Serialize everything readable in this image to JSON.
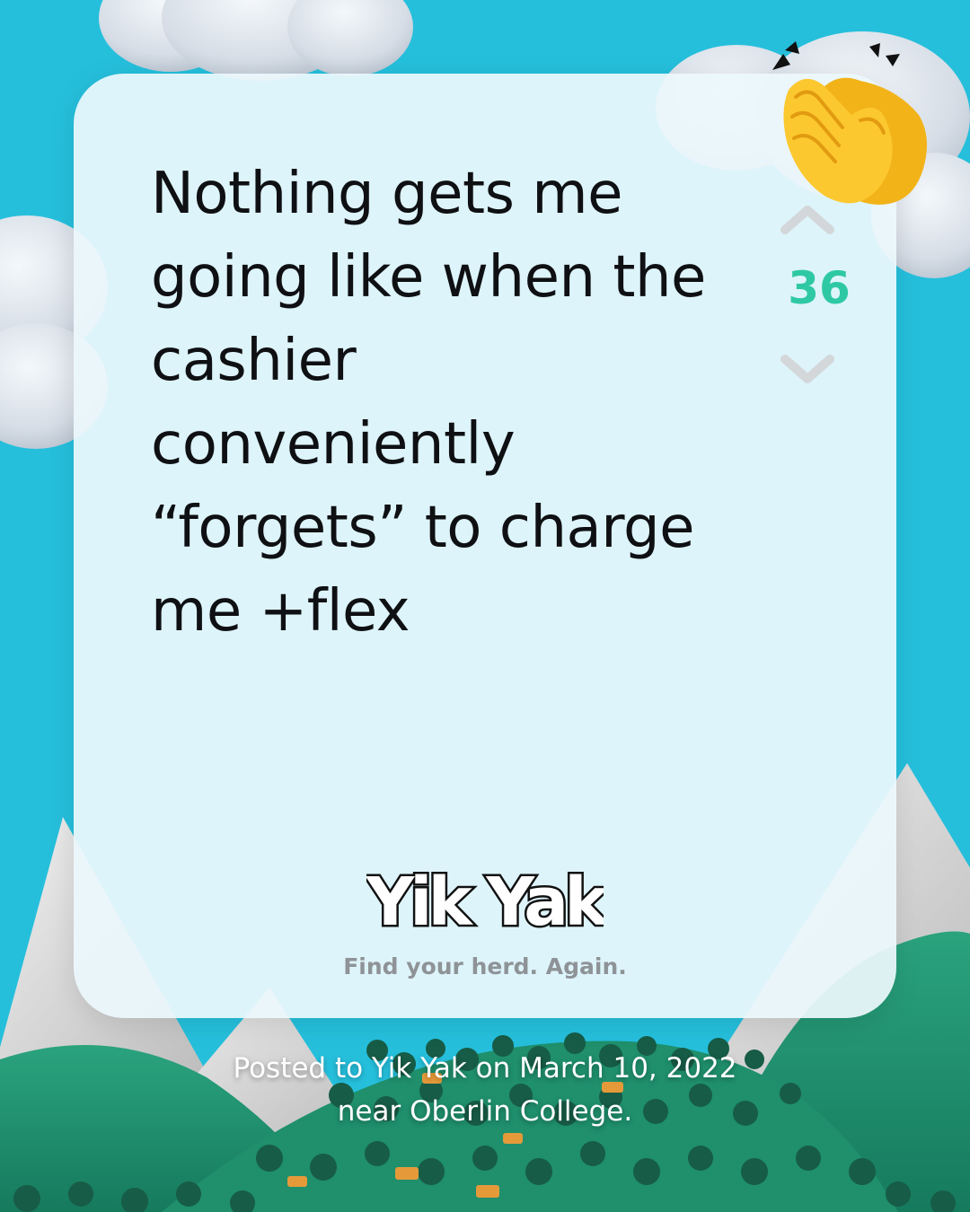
{
  "post": {
    "text": "Nothing gets me going like when the cashier conveniently “forgets” to charge me +flex",
    "vote_count": "36"
  },
  "brand": {
    "logo_text": "Yik Yak",
    "tagline": "Find your herd. Again."
  },
  "caption": {
    "line1": "Posted to Yik Yak on March 10, 2022",
    "line2": "near Oberlin College."
  },
  "icons": {
    "upvote": "chevron-up-icon",
    "downvote": "chevron-down-icon",
    "reaction": "clapping-hands-icon"
  },
  "colors": {
    "background": "#25bfdc",
    "vote_count": "#2ec9a4",
    "text": "#0f1013"
  }
}
